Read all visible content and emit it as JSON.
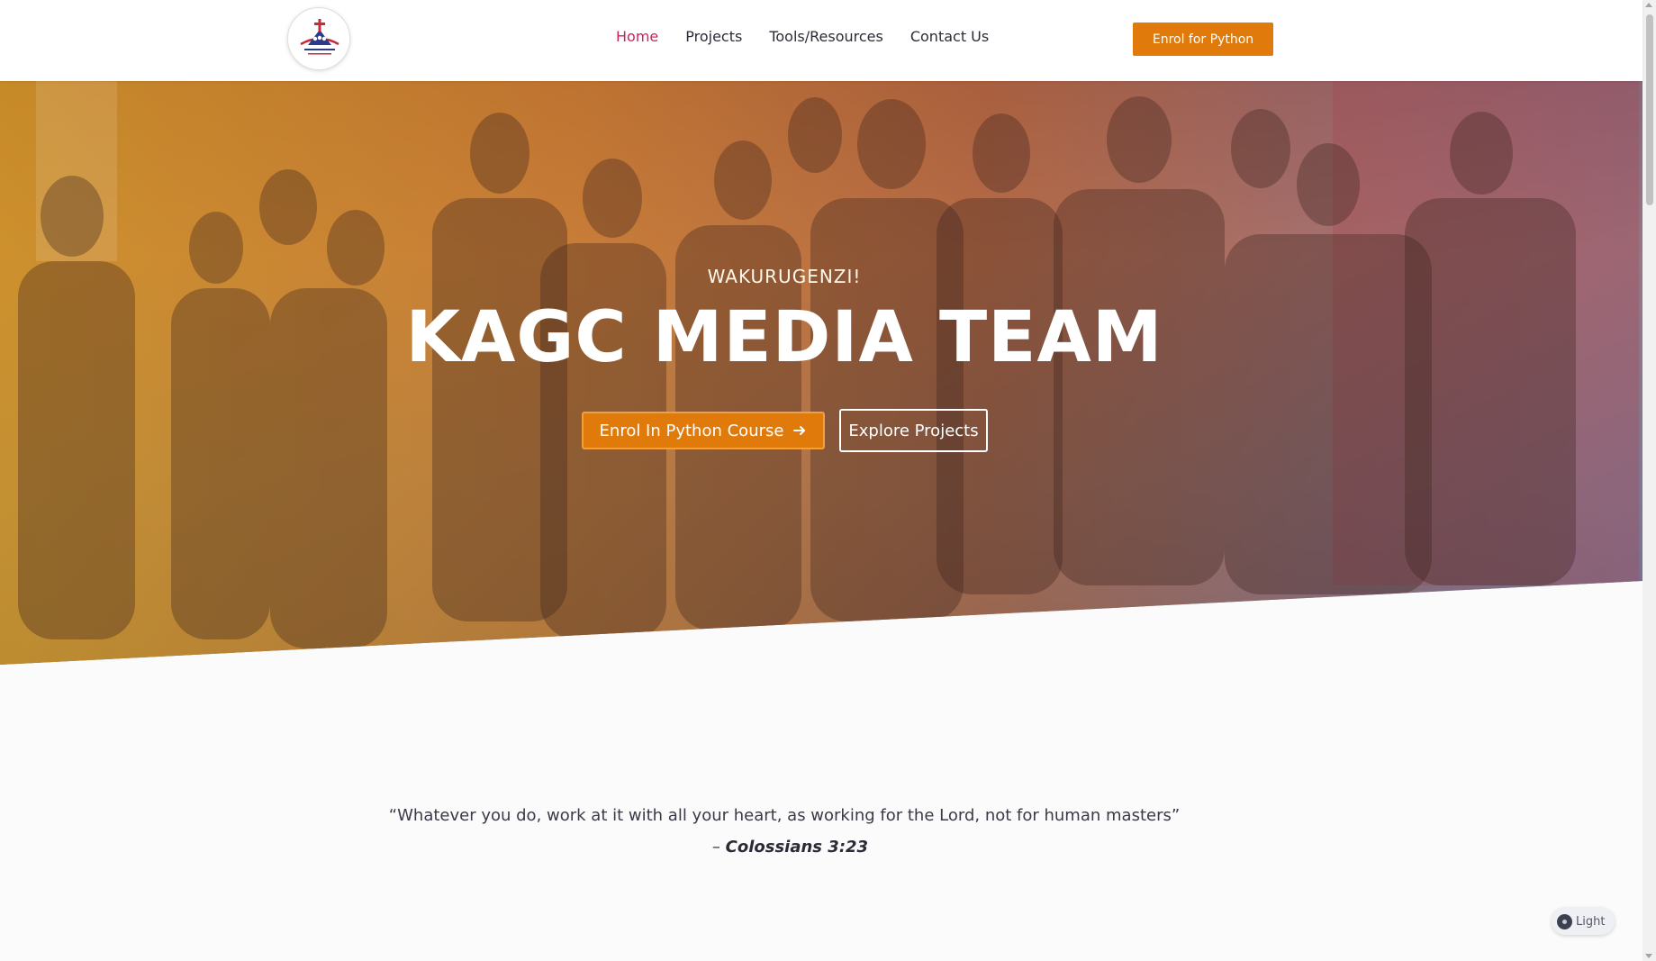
{
  "header": {
    "logo_alt": "Kenya Africa Gospel Church logo",
    "logo_text": "Kenya Africa Gospel Church",
    "nav": [
      {
        "label": "Home",
        "active": true
      },
      {
        "label": "Projects",
        "active": false
      },
      {
        "label": "Tools/Resources",
        "active": false
      },
      {
        "label": "Contact Us",
        "active": false
      }
    ],
    "cta_label": "Enrol for Python"
  },
  "hero": {
    "subtitle": "WAKURUGENZI!",
    "title": "KAGC MEDIA TEAM",
    "primary_button": "Enrol In Python Course",
    "primary_button_icon": "arrow-right-icon",
    "secondary_button": "Explore Projects"
  },
  "quote": {
    "text": "“Whatever you do, work at it with all your heart, as working for the Lord, not for human masters”",
    "dash": "–",
    "reference": "Colossians 3:23"
  },
  "theme_toggle": {
    "label": "Light"
  },
  "colors": {
    "accent": "#e07a0b",
    "nav_active": "#d1215e",
    "nav_text": "#2b2b38"
  }
}
